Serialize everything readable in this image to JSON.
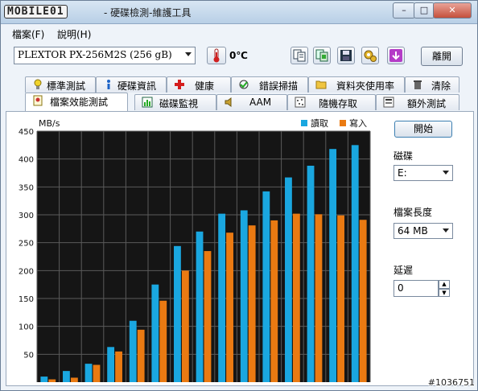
{
  "window": {
    "logo_text": "MOBILE01",
    "title": "- 硬碟檢測-維護工具",
    "controls": [
      "–",
      "□",
      "✕"
    ]
  },
  "menu": {
    "items": [
      "檔案(F)",
      "說明(H)"
    ]
  },
  "toolbar": {
    "drive": "PLEXTOR  PX-256M2S (256 gB)",
    "temperature": "0℃",
    "exit_label": "離開"
  },
  "tabs": {
    "row1": [
      "標準測試",
      "硬碟資訊",
      "健康",
      "錯誤掃描",
      "資料夾使用率",
      "清除"
    ],
    "row2": [
      "檔案效能測試",
      "磁碟監視",
      "AAM",
      "隨機存取",
      "額外測試"
    ],
    "active": "檔案效能測試"
  },
  "controls": {
    "start_label": "開始",
    "disk_label": "磁碟",
    "disk_value": "E:",
    "file_length_label": "檔案長度",
    "file_length_value": "64 MB",
    "delay_label": "延遲",
    "delay_value": "0"
  },
  "chart_data": {
    "type": "bar",
    "ylabel": "MB/s",
    "yticks": [
      50,
      100,
      150,
      200,
      250,
      300,
      350,
      400,
      450
    ],
    "ylim": [
      0,
      450
    ],
    "grid": true,
    "legend_position": "top-right",
    "colors": {
      "read": "#1aa7e0",
      "write": "#ea7a12",
      "background": "#151515",
      "grid": "#5a5a5a"
    },
    "series": [
      {
        "name": "讀取",
        "values": [
          10,
          20,
          33,
          63,
          110,
          175,
          244,
          270,
          302,
          308,
          342,
          367,
          388,
          418,
          425
        ]
      },
      {
        "name": "寫入",
        "values": [
          5,
          8,
          31,
          55,
          94,
          146,
          200,
          235,
          268,
          281,
          290,
          302,
          301,
          299,
          291
        ]
      }
    ]
  },
  "watermark": "#1036751"
}
